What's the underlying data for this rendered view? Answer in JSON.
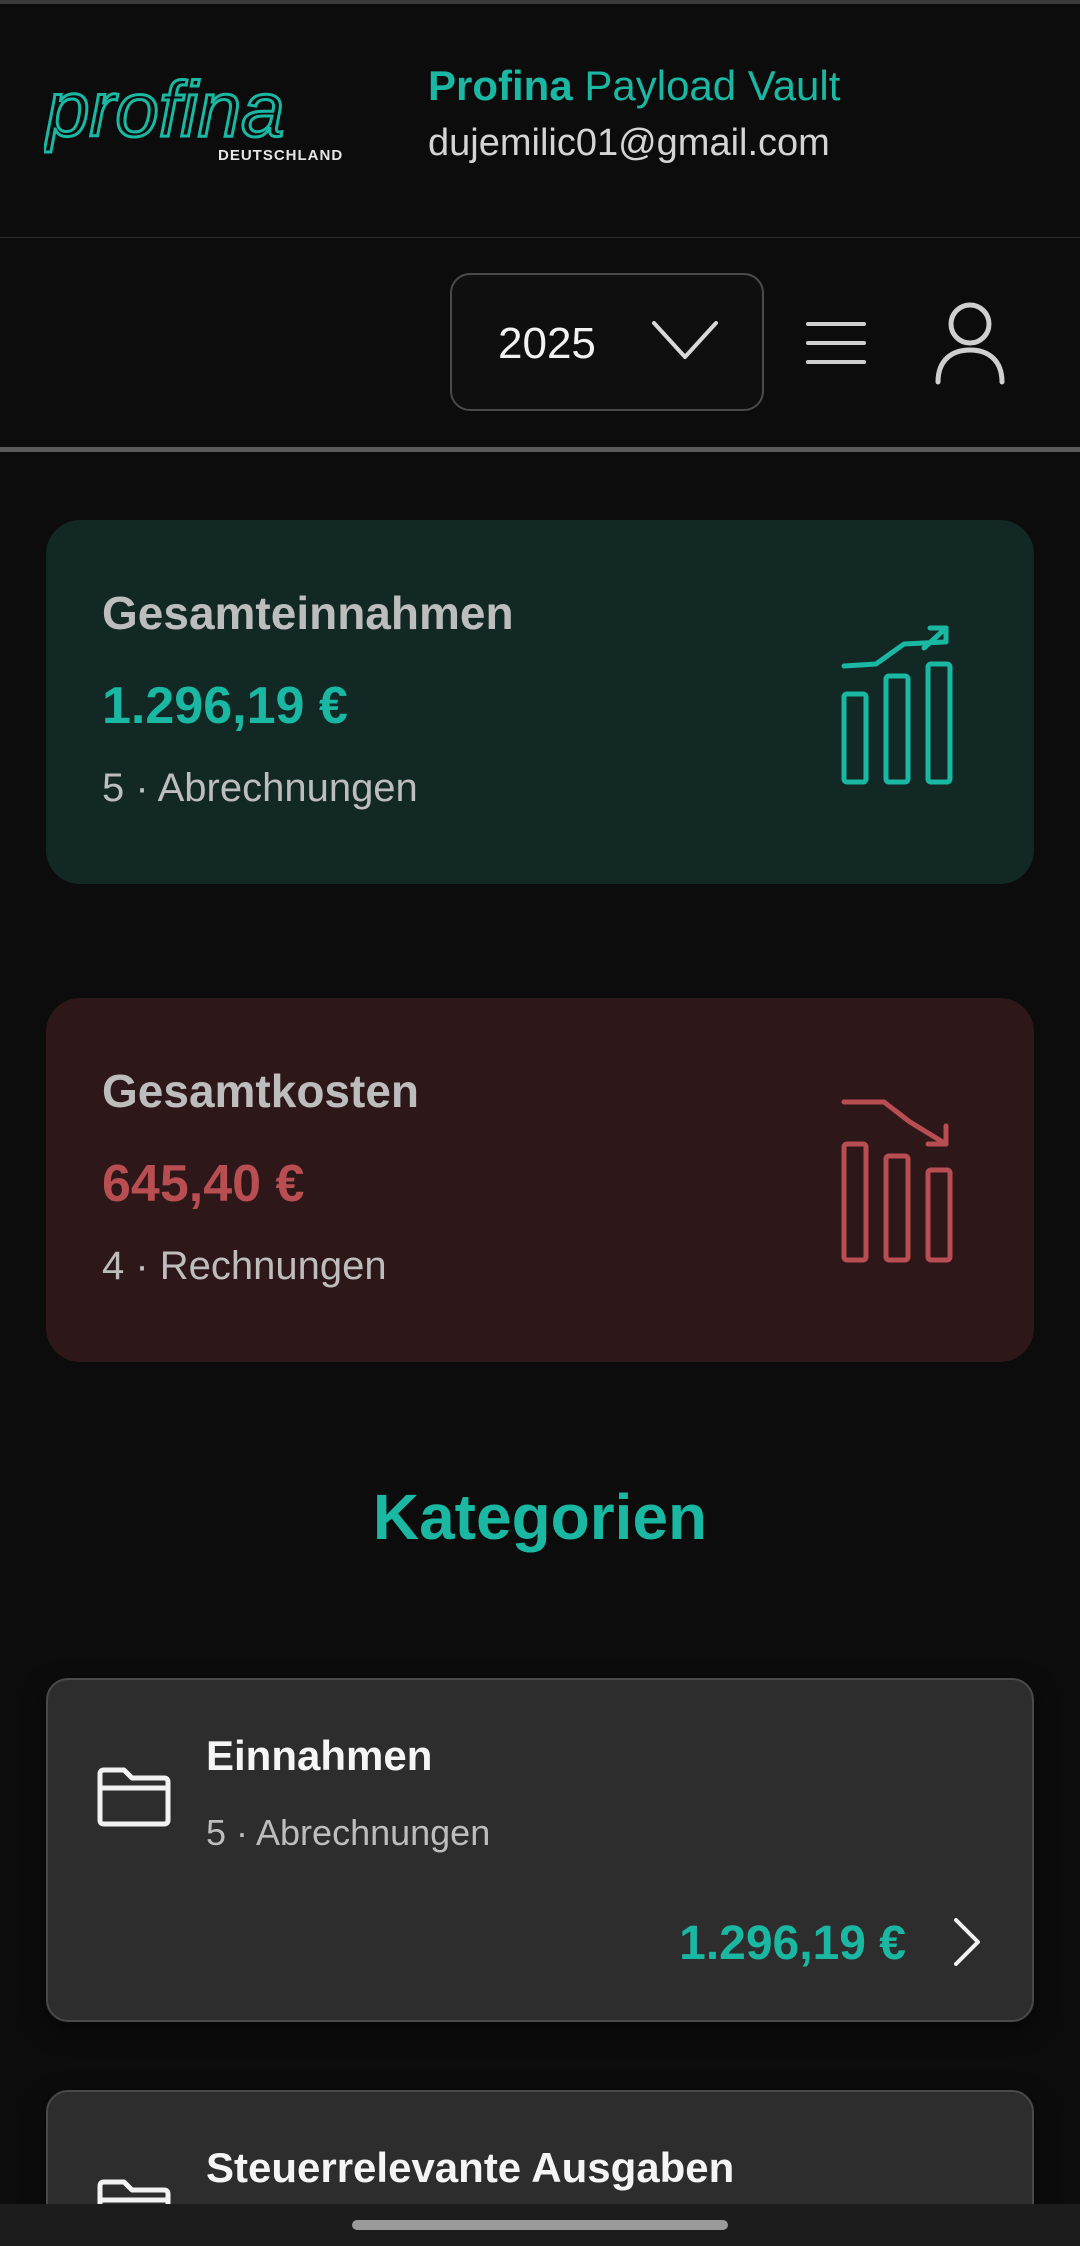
{
  "header": {
    "logo_text": "profina",
    "logo_subtext": "DEUTSCHLAND",
    "brand": "Profina",
    "app_name": "Payload Vault",
    "user_email": "dujemilic01@gmail.com"
  },
  "toolbar": {
    "year": "2025",
    "year_chevron_icon": "chevron-down-icon",
    "menu_icon": "hamburger-menu-icon",
    "profile_icon": "user-profile-icon"
  },
  "summary": {
    "income": {
      "title": "Gesamteinnahmen",
      "amount": "1.296,19 €",
      "count_text": "5 · Abrechnungen",
      "icon": "chart-trend-up-icon",
      "accent_color": "#1ab8a3"
    },
    "costs": {
      "title": "Gesamtkosten",
      "amount": "645,40 €",
      "count_text": "4 · Rechnungen",
      "icon": "chart-trend-down-icon",
      "accent_color": "#b84e52"
    }
  },
  "categories": {
    "title": "Kategorien",
    "items": [
      {
        "name": "Einnahmen",
        "count_text": "5 · Abrechnungen",
        "amount": "1.296,19 €",
        "icon": "folder-icon"
      },
      {
        "name": "Steuerrelevante Ausgaben",
        "icon": "folder-icon"
      }
    ]
  }
}
